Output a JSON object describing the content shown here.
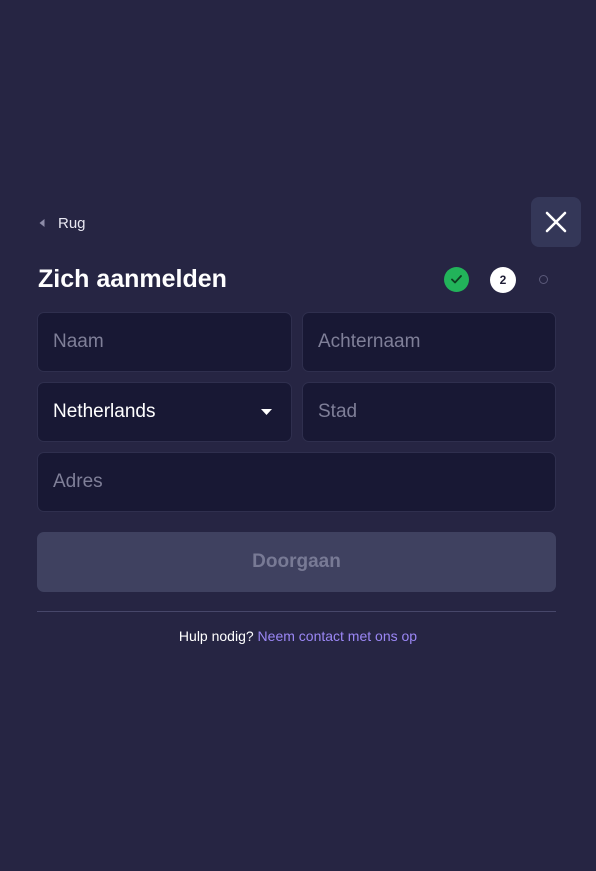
{
  "nav": {
    "back_label": "Rug",
    "back_icon": "chevron-left-icon",
    "close_icon": "close-icon"
  },
  "form": {
    "title": "Zich aanmelden",
    "steps": [
      {
        "state": "done",
        "icon": "check-icon"
      },
      {
        "state": "current",
        "label": "2"
      },
      {
        "state": "upcoming"
      }
    ],
    "fields": {
      "first_name": {
        "placeholder": "Naam",
        "value": ""
      },
      "last_name": {
        "placeholder": "Achternaam",
        "value": ""
      },
      "country": {
        "value": "Netherlands",
        "icon": "caret-down-icon"
      },
      "city": {
        "placeholder": "Stad",
        "value": ""
      },
      "address": {
        "placeholder": "Adres",
        "value": ""
      }
    },
    "submit_label": "Doorgaan",
    "submit_enabled": false
  },
  "help": {
    "question": "Hulp nodig?",
    "link_label": "Neem contact met ons op"
  },
  "colors": {
    "background": "#262543",
    "input_background": "#181834",
    "step_done": "#22b35a",
    "link": "#9b87f5",
    "button_disabled": "#3f4160"
  }
}
